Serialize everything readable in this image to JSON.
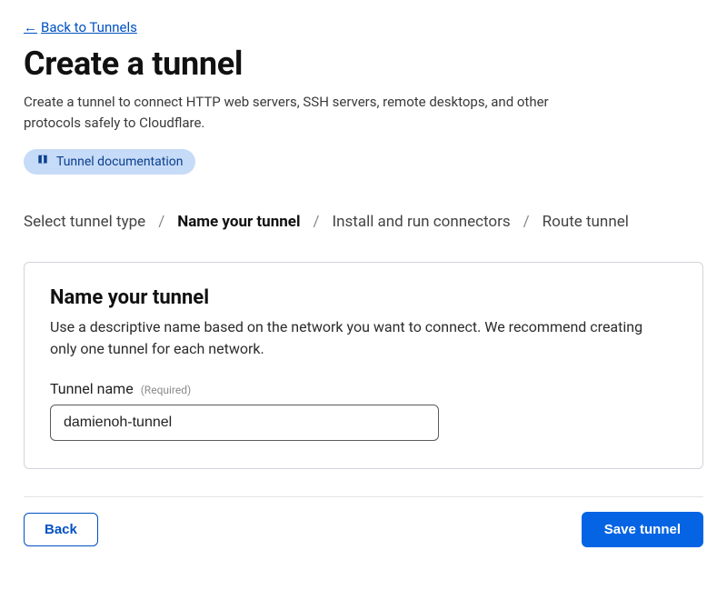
{
  "header": {
    "back_link": "Back to Tunnels",
    "title": "Create a tunnel",
    "description": "Create a tunnel to connect HTTP web servers, SSH servers, remote desktops, and other protocols safely to Cloudflare.",
    "doc_chip": "Tunnel documentation"
  },
  "steps": {
    "items": [
      {
        "label": "Select tunnel type",
        "active": false
      },
      {
        "label": "Name your tunnel",
        "active": true
      },
      {
        "label": "Install and run connectors",
        "active": false
      },
      {
        "label": "Route tunnel",
        "active": false
      }
    ],
    "separator": "/"
  },
  "panel": {
    "title": "Name your tunnel",
    "description": "Use a descriptive name based on the network you want to connect. We recommend creating only one tunnel for each network.",
    "field_label": "Tunnel name",
    "field_required": "(Required)",
    "field_value": "damienoh-tunnel"
  },
  "footer": {
    "back": "Back",
    "save": "Save tunnel"
  }
}
